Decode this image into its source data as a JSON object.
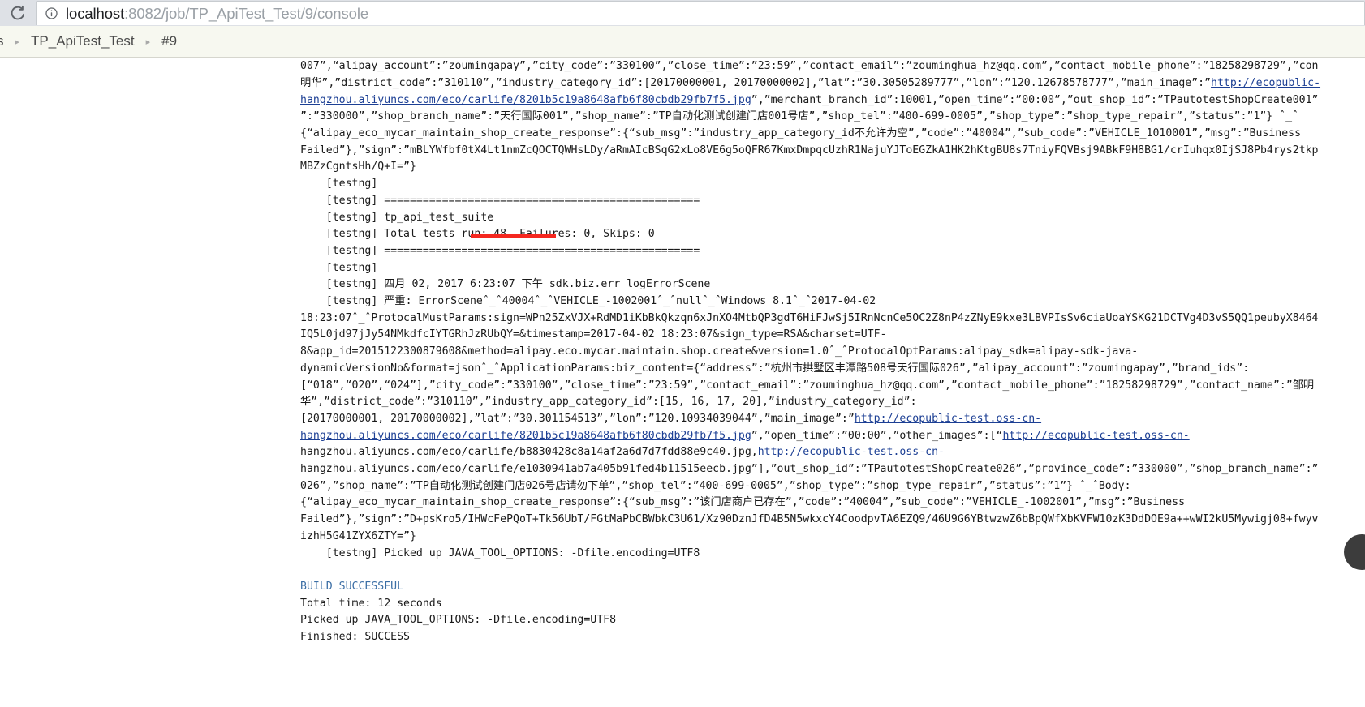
{
  "browser": {
    "reload_icon": "reload-icon",
    "info_icon": "page-info-icon",
    "url_host": "localhost",
    "url_path": ":8082/job/TP_ApiTest_Test/9/console",
    "url_full": "localhost:8082/job/TP_ApiTest_Test/9/console"
  },
  "breadcrumb": {
    "items": [
      {
        "label": "s"
      },
      {
        "label": "TP_ApiTest_Test"
      },
      {
        "label": "#9"
      }
    ],
    "separator": "▸"
  },
  "console": {
    "highlight_color": "#f5271f",
    "link_color": "#1c3f94",
    "build_status_color": "#3b6ea5",
    "lines": [
      "007”,“alipay_account”:”zoumingapay”,”city_code”:”330100”,”close_time”:”23:59”,”contact_email”:”zouminghua_hz@qq.com”,”contact_mobile_phone”:”18258298729”,”con",
      "明华”,”district_code”:”310110”,”industry_category_id”:[20170000001, 20170000002],”lat”:”30.30505289777”,”lon”:”120.12678578777”,”main_image”:”http://ecopublic-",
      "hangzhou.aliyuncs.com/eco/carlife/8201b5c19a8648afb6f80cbdb29fb7f5.jpg”,”merchant_branch_id”:10001,”open_time”:”00:00”,”out_shop_id”:”TPautotestShopCreate001”",
      "”:”330000”,”shop_branch_name”:”天行国际001”,”shop_name”:”TP自动化测试创建门店001号店”,”shop_tel”:”400-699-0005”,”shop_type”:”shop_type_repair”,”status”:”1”} ˆ_ˆ",
      "{“alipay_eco_mycar_maintain_shop_create_response”:{“sub_msg”:”industry_app_category_id不允许为空”,”code”:”40004”,”sub_code”:”VEHICLE_1010001”,”msg”:”Business",
      "Failed”},”sign”:”mBLYWfbf0tX4Lt1nmZcQOCTQWHsLDy/aRmAIcBSqG2xLo8VE6g5oQFR67KmxDmpqcUzhR1NajuYJToEGZkA1HK2hKtgBU8s7TniyFQVBsj9ABkF9H8BG1/crIuhqx0IjSJ8Pb4rys2tkp",
      "MBZzCgntsHh/Q+I=”}",
      "    [testng]",
      "    [testng] =================================================",
      "    [testng] tp_api_test_suite",
      "    [testng] Total tests run: 48, Failures: 0, Skips: 0",
      "    [testng] =================================================",
      "    [testng]",
      "    [testng] 四月 02, 2017 6:23:07 下午 sdk.biz.err logErrorScene",
      "    [testng] 严重: ErrorSceneˆ_ˆ40004ˆ_ˆVEHICLE_-1002001ˆ_ˆnullˆ_ˆWindows 8.1ˆ_ˆ2017-04-02",
      "18:23:07ˆ_ˆProtocalMustParams:sign=WPn25ZxVJX+RdMD1iKbBkQkzqn6xJnXO4MtbQP3gdT6HiFJwSj5IRnNcnCe5OC2Z8nP4zZNyE9kxe3LBVPIsSv6ciaUoaYSKG21DCTVg4D3vS5QQ1peubyX8464",
      "IQ5L0jd97jJy54NMkdfcIYTGRhJzRUbQY=&timestamp=2017-04-02 18:23:07&sign_type=RSA&charset=UTF-",
      "8&app_id=2015122300879608&method=alipay.eco.mycar.maintain.shop.create&version=1.0ˆ_ˆProtocalOptParams:alipay_sdk=alipay-sdk-java-",
      "dynamicVersionNo&format=jsonˆ_ˆApplicationParams:biz_content={“address”:”杭州市拱墅区丰潭路508号天行国际026”,”alipay_account”:”zoumingapay”,”brand_ids”:",
      "[“018”,“020”,“024”],”city_code”:”330100”,”close_time”:”23:59”,”contact_email”:”zouminghua_hz@qq.com”,”contact_mobile_phone”:”18258298729”,”contact_name”:”邹明",
      "华”,”district_code”:”310110”,”industry_app_category_id”:[15, 16, 17, 20],”industry_category_id”:",
      "[20170000001, 20170000002],”lat”:”30.301154513”,”lon”:”120.10934039044”,”main_image”:”http://ecopublic-test.oss-cn-",
      "hangzhou.aliyuncs.com/eco/carlife/8201b5c19a8648afb6f80cbdb29fb7f5.jpg”,”open_time”:”00:00”,”other_images”:[“http://ecopublic-test.oss-cn-",
      "hangzhou.aliyuncs.com/eco/carlife/b8830428c8a14af2a6d7d7fdd88e9c40.jpg,http://ecopublic-test.oss-cn-",
      "hangzhou.aliyuncs.com/eco/carlife/e1030941ab7a405b91fed4b11515eecb.jpg”],”out_shop_id”:”TPautotestShopCreate026”,”province_code”:”330000”,”shop_branch_name”:”",
      "026”,”shop_name”:”TP自动化测试创建门店026号店请勿下单”,”shop_tel”:”400-699-0005”,”shop_type”:”shop_type_repair”,”status”:”1”} ˆ_ˆBody:",
      "{“alipay_eco_mycar_maintain_shop_create_response”:{“sub_msg”:”该门店商户已存在”,”code”:”40004”,”sub_code”:”VEHICLE_-1002001”,”msg”:”Business",
      "Failed”},”sign”:”D+psKro5/IHWcFePQoT+Tk56UbT/FGtMaPbCBWbkC3U61/Xz90DznJfD4B5N5wkxcY4CoodpvTA6EZQ9/46U9G6YBtwzwZ6bBpQWfXbKVFW10zK3DdDOE9a++wWI2kU5Mywigj08+fwyv",
      "izhH5G41ZYX6ZTY=”}",
      "    [testng] Picked up JAVA_TOOL_OPTIONS: -Dfile.encoding=UTF8",
      "",
      "BUILD SUCCESSFUL",
      "Total time: 12 seconds",
      "Picked up JAVA_TOOL_OPTIONS: -Dfile.encoding=UTF8",
      "Finished: SUCCESS"
    ],
    "link_segments": [
      "http://ecopublic-",
      "hangzhou.aliyuncs.com/eco/carlife/8201b5c19a8648afb6f80cbdb29fb7f5.jpg",
      "http://ecopublic-test.oss-cn-",
      "hangzhou.aliyuncs.com/eco/carlife/8201b5c19a8648afb6f80cbdb29fb7f5.jpg"
    ],
    "build_status_line": "BUILD SUCCESSFUL",
    "total_time_line": "Total time: 12 seconds",
    "picked_up_line": "Picked up JAVA_TOOL_OPTIONS: -Dfile.encoding=UTF8",
    "finished_line": "Finished: SUCCESS"
  }
}
